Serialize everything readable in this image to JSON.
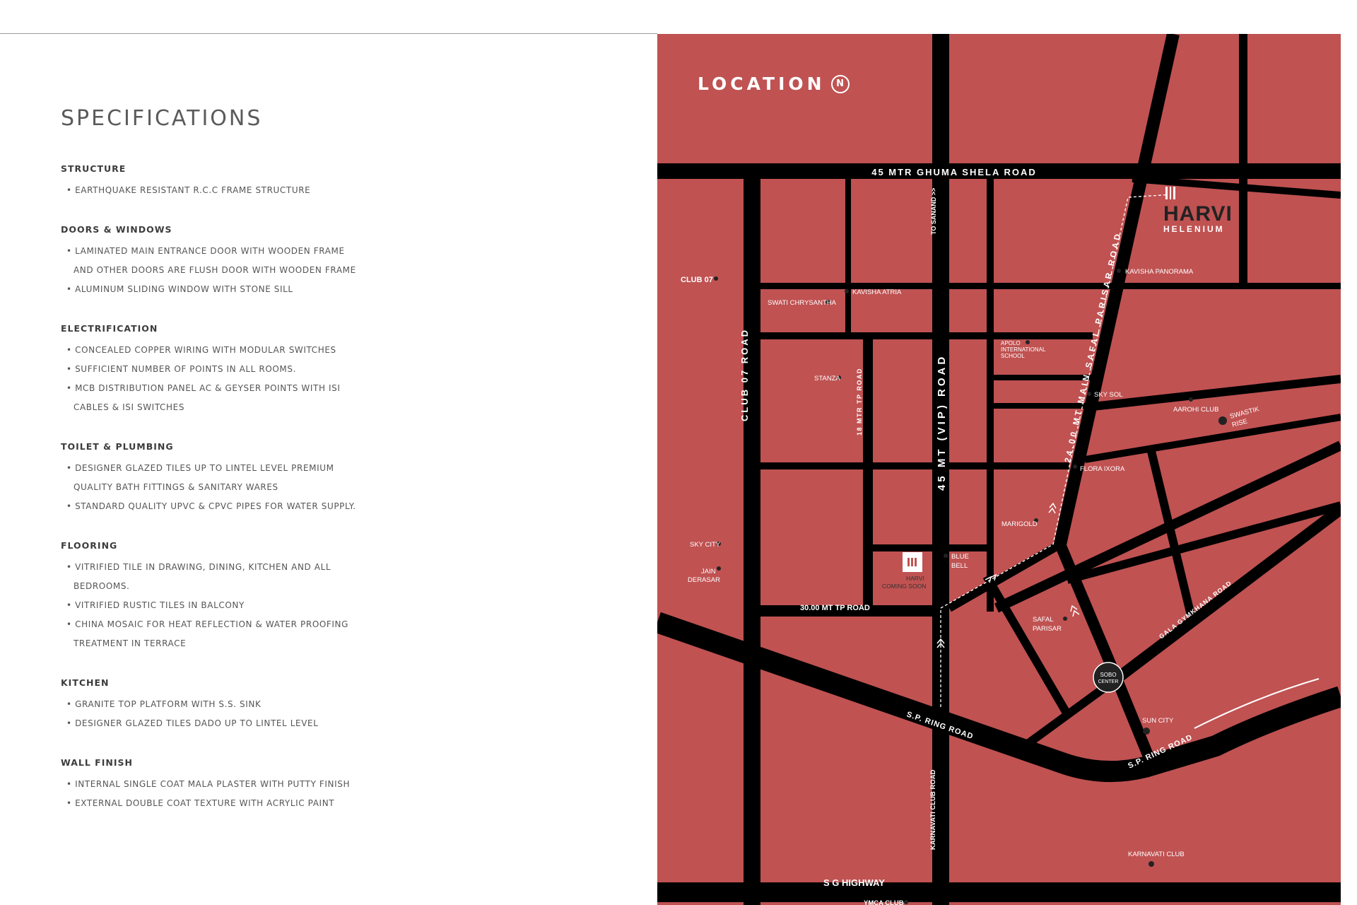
{
  "specifications": {
    "title": "SPECIFICATIONS",
    "sections": [
      {
        "heading": "STRUCTURE",
        "items": [
          "EARTHQUAKE RESISTANT R.C.C FRAME STRUCTURE"
        ]
      },
      {
        "heading": "DOORS & WINDOWS",
        "items": [
          "LAMINATED MAIN ENTRANCE DOOR WITH WOODEN FRAME\nAND OTHER DOORS ARE FLUSH DOOR WITH WOODEN FRAME",
          "ALUMINUM SLIDING WINDOW WITH STONE SILL"
        ]
      },
      {
        "heading": "ELECTRIFICATION",
        "items": [
          "CONCEALED COPPER WIRING WITH MODULAR SWITCHES",
          "SUFFICIENT NUMBER OF POINTS IN ALL ROOMS.",
          "MCB DISTRIBUTION PANEL AC & GEYSER POINTS WITH ISI\nCABLES & ISI SWITCHES"
        ]
      },
      {
        "heading": "TOILET & PLUMBING",
        "items": [
          "DESIGNER GLAZED TILES UP TO LINTEL LEVEL PREMIUM\nQUALITY BATH FITTINGS & SANITARY WARES",
          "STANDARD QUALITY UPVC & CPVC PIPES FOR WATER SUPPLY."
        ]
      },
      {
        "heading": "FLOORING",
        "items": [
          "VITRIFIED TILE IN DRAWING, DINING, KITCHEN AND ALL\nBEDROOMS.",
          "VITRIFIED RUSTIC TILES IN BALCONY",
          "CHINA MOSAIC FOR HEAT REFLECTION & WATER PROOFING\nTREATMENT IN TERRACE"
        ]
      },
      {
        "heading": "KITCHEN",
        "items": [
          "GRANITE TOP PLATFORM WITH S.S. SINK",
          "DESIGNER GLAZED TILES DADO UP TO LINTEL LEVEL"
        ]
      },
      {
        "heading": "WALL FINISH",
        "items": [
          "INTERNAL SINGLE COAT MALA PLASTER WITH PUTTY FINISH",
          "EXTERNAL DOUBLE COAT TEXTURE WITH ACRYLIC PAINT"
        ]
      }
    ]
  },
  "map": {
    "title": "LOCATION",
    "compass_glyph": "N",
    "colors": {
      "land": "#c05252",
      "road": "#000000",
      "label": "#ffffff",
      "landmark": "#222222"
    },
    "roads": {
      "ghuma_shela": "45 MTR GHUMA SHELA ROAD",
      "vip": "45 MT (VIP) ROAD",
      "club07": "CLUB 07 ROAD",
      "tp18": "18 MTR TP ROAD",
      "tp30": "30.00 MT TP ROAD",
      "safal_parisar": "24.00 MT MAIN SAFAL PARISAR ROAD",
      "sp_ring_1": "S.P. RING ROAD",
      "sp_ring_2": "S.P. RING ROAD",
      "gala_gymkhana": "GALA GYMKHANA ROAD",
      "karnavati_club_road": "KARNAVATI CLUB ROAD",
      "sg_highway": "S G HIGHWAY",
      "to_sanand": "TO SANAND >>"
    },
    "project": {
      "name": "HARVI",
      "subtitle": "HELENIUM"
    },
    "sobo": {
      "line1": "SOBO",
      "line2": "CENTER"
    },
    "landmarks": {
      "club07": "CLUB 07",
      "kavisha_atria": "KAVISHA ATRIA",
      "swati": "SWATI CHRYSANTHA",
      "kavisha_panorama": "KAVISHA PANORAMA",
      "apolo_1": "APOLO",
      "apolo_2": "INTERNATIONAL",
      "apolo_3": "SCHOOL",
      "stanza": "STANZA",
      "sky_sol": "SKY SOL",
      "aarohi": "AAROHI CLUB",
      "swastik_1": "SWASTIK",
      "swastik_2": "RISE",
      "flora": "FLORA IXORA",
      "marigold": "MARIGOLD",
      "sky_city": "SKY CITY",
      "jain_1": "JAIN",
      "jain_2": "DERASAR",
      "blue_1": "BLUE",
      "blue_2": "BELL",
      "harvi_cs_1": "HARVI",
      "harvi_cs_2": "COMING SOON",
      "safal_1": "SAFAL",
      "safal_2": "PARISAR",
      "sun_city": "SUN CITY",
      "karnavati_club": "KARNAVATI CLUB",
      "ymca": "YMCA CLUB"
    }
  }
}
